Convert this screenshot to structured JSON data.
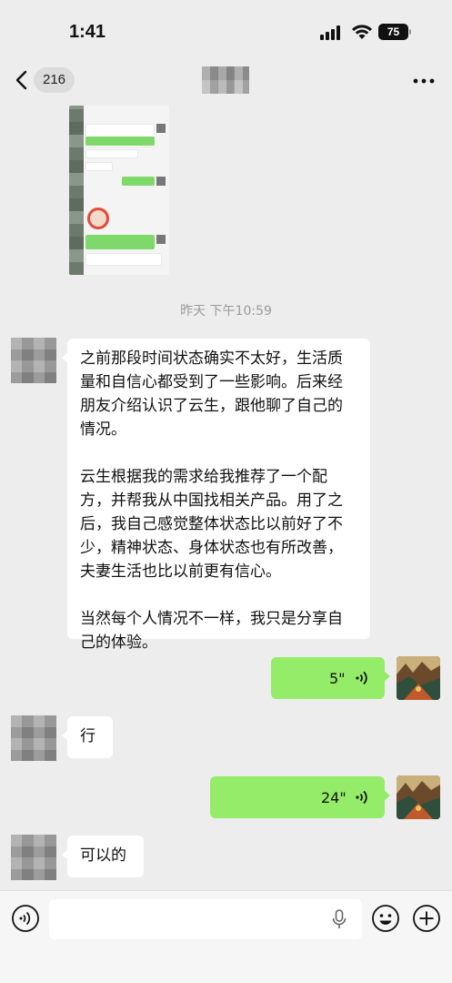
{
  "status_bar": {
    "time": "1:41",
    "battery": "75"
  },
  "nav": {
    "unread_count": "216"
  },
  "messages": {
    "timestamp": "昨天 下午10:59",
    "long_text": {
      "para1": "之前那段时间状态确实不太好，生活质量和自信心都受到了一些影响。后来经朋友介绍认识了云生，跟他聊了自己的情况。",
      "para2": "云生根据我的需求给我推荐了一个配方，并帮我从中国找相关产品。用了之后，我自己感觉整体状态比以前好了不少，精神状态、身体状态也有所改善，夫妻生活也比以前更有信心。",
      "para3": "当然每个人情况不一样，我只是分享自己的体验。"
    },
    "voice1_duration": "5\"",
    "reply1": "行",
    "voice2_duration": "24\"",
    "reply2": "可以的"
  },
  "colors": {
    "background": "#ededed",
    "outgoing_bubble": "#95ec69",
    "incoming_bubble": "#ffffff",
    "timestamp_text": "#9b9b9b"
  },
  "icons": [
    "back-chevron-icon",
    "more-dots-icon",
    "voice-wave-icon",
    "voice-mode-icon",
    "mic-icon",
    "emoji-icon",
    "plus-icon",
    "signal-icon",
    "wifi-icon"
  ]
}
